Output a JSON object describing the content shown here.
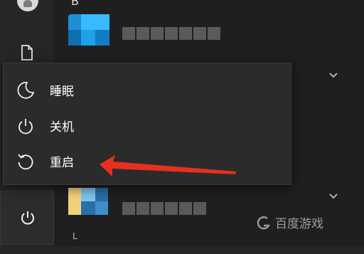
{
  "sidebar": {
    "user_avatar": "user-avatar",
    "documents_icon": "document-icon",
    "power_icon": "power-icon"
  },
  "apps": {
    "group_letter_top": "B",
    "group_letter_bottom": "L",
    "tile_colors": [
      "#23a7f0",
      "#f1d27a"
    ]
  },
  "power_menu": {
    "items": [
      {
        "label": "睡眠",
        "icon": "moon-icon"
      },
      {
        "label": "关机",
        "icon": "power-icon"
      },
      {
        "label": "重启",
        "icon": "restart-icon"
      }
    ]
  },
  "watermark": {
    "text": "百度游戏"
  },
  "annotation": {
    "arrow_color": "#e8301f"
  }
}
